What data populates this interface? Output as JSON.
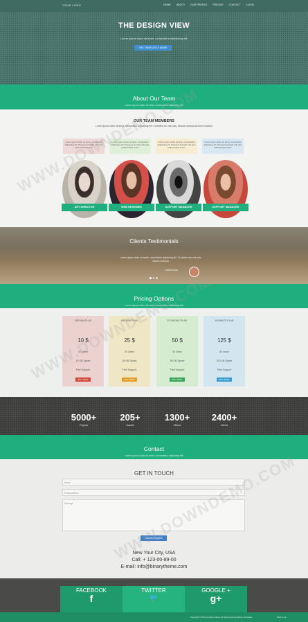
{
  "nav": {
    "logo": "YOUR LOGO",
    "items": [
      "HOME",
      "ABOUT",
      "OUR PROFILE",
      "PRICING",
      "CONTACT",
      "LOGIN"
    ]
  },
  "hero": {
    "title": "THE DESIGN VIEW",
    "subtitle": "Lorem ipsum dolor sit amet, consectetur adipiscing elit.",
    "button": "THE TEMPLATE & MORE"
  },
  "about": {
    "title": "About Our Team",
    "subtitle": "Lorem ipsum dolor sit amet, consectetur adipiscing elit",
    "members_title": "OUR TEAM MEMBERS",
    "members_text": "Lorem ipsum dolor sit amet, consectetur adipiscing elit. Curabitur nec nisl odio. Mauris vehicula at tortor tincidunt",
    "quote": "Lorem ipsum dolor sit amet, consectetur adipiscing elit. Praesent suscipit velit quis pellentesque amet.",
    "members": [
      {
        "role": "ART DIRECTOR",
        "quote_color": "#eed9d6"
      },
      {
        "role": "WEB DESIGNER",
        "quote_color": "#e0f0d8"
      },
      {
        "role": "SUPPORT MANAGER",
        "quote_color": "#f6ecd2"
      },
      {
        "role": "SUPPORT MANAGER",
        "quote_color": "#d8e7f1"
      }
    ]
  },
  "testimonials": {
    "title": "Clients Testimonials",
    "quote": "Lorem ipsum dolor sit amet, consectetur adipiscing elit. Curabitur nec nisl odio. Mauris vehicula.",
    "author": "Lorem Dust"
  },
  "pricing": {
    "title": "Pricing Options",
    "subtitle": "Lorem ipsum dolor sit amet, consectetur adipiscing elit",
    "plans": [
      {
        "name": "MEDIUM PLAN",
        "price": "10 $",
        "l1": "10 Users",
        "l2": "10 GB Space",
        "l3": "Free Support",
        "button": "BUY NOW",
        "color": "#ecd2ce",
        "btn": "#d24a3d"
      },
      {
        "name": "MEDIUM PLAN",
        "price": "25 $",
        "l1": "20 Users",
        "l2": "25 GB Space",
        "l3": "Free Support",
        "button": "BUY NOW",
        "color": "#efe6c6",
        "btn": "#e49d2d"
      },
      {
        "name": "ECONOMY PLAN",
        "price": "50 $",
        "l1": "30 Users",
        "l2": "50 GB Space",
        "l3": "Free Support",
        "button": "BUY NOW",
        "color": "#d6ecd0",
        "btn": "#3aa65b"
      },
      {
        "name": "ADVANCE PLAN",
        "price": "125 $",
        "l1": "50 Users",
        "l2": "100 GB Space",
        "l3": "Free Support",
        "button": "BUY NOW",
        "color": "#d3e5ef",
        "btn": "#3b9ed2"
      }
    ]
  },
  "stats": [
    {
      "num": "5000+",
      "label": "Projects"
    },
    {
      "num": "205+",
      "label": "Awards"
    },
    {
      "num": "1300+",
      "label": "Offices"
    },
    {
      "num": "2400+",
      "label": "Clients"
    }
  ],
  "contact": {
    "title": "Contact",
    "subtitle": "Lorem ipsum dolor sit amet, consectetur adipiscing elit",
    "heading": "GET IN TOUCH",
    "name_ph": "Name",
    "email_ph": "Email Address",
    "message_ph": "Message",
    "submit": "Submit Request",
    "address": "New Your City, USA",
    "call": "Call: + 123-00-89-00",
    "email": "E-mail: info@binarytheme.com"
  },
  "social": [
    {
      "label": "FACEBOOK",
      "icon": "f",
      "bg": "#1e9a6d"
    },
    {
      "label": "TWITTER",
      "icon": "🐦",
      "bg": "#25b47f"
    },
    {
      "label": "GOOGLE +",
      "icon": "g+",
      "bg": "#1e9a6d"
    }
  ],
  "footer": {
    "copyright": "Copyright © 2014 Company Name. All rights reserved. Binary Templates",
    "link": "Back to top"
  },
  "watermark": "WWW.DOWNDEMO.COM"
}
